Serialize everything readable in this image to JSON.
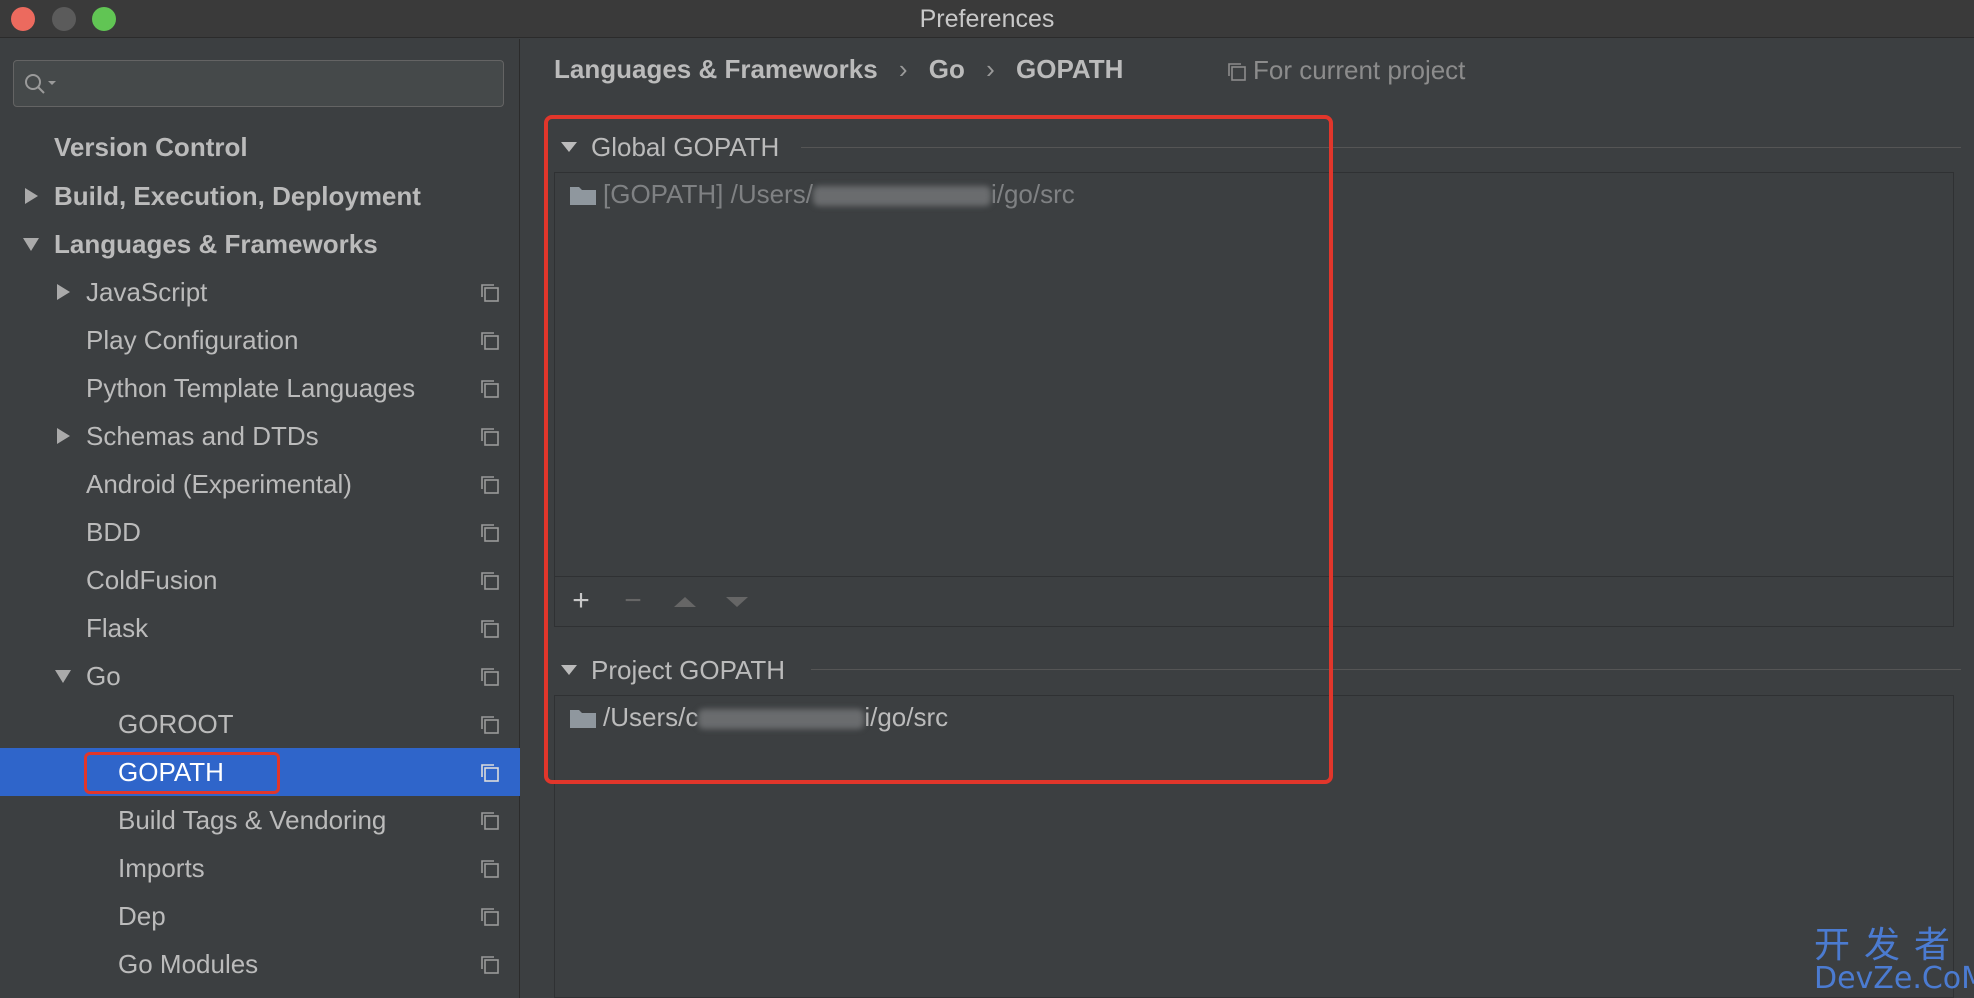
{
  "window": {
    "title": "Preferences"
  },
  "search": {
    "placeholder": ""
  },
  "sidebar": {
    "items": [
      {
        "label": "Version Control"
      },
      {
        "label": "Build, Execution, Deployment"
      },
      {
        "label": "Languages & Frameworks"
      },
      {
        "label": "JavaScript"
      },
      {
        "label": "Play Configuration"
      },
      {
        "label": "Python Template Languages"
      },
      {
        "label": "Schemas and DTDs"
      },
      {
        "label": "Android (Experimental)"
      },
      {
        "label": "BDD"
      },
      {
        "label": "ColdFusion"
      },
      {
        "label": "Flask"
      },
      {
        "label": "Go"
      },
      {
        "label": "GOROOT"
      },
      {
        "label": "GOPATH"
      },
      {
        "label": "Build Tags & Vendoring"
      },
      {
        "label": "Imports"
      },
      {
        "label": "Dep"
      },
      {
        "label": "Go Modules"
      }
    ],
    "selected": "GOPATH"
  },
  "breadcrumb": {
    "parts": [
      "Languages & Frameworks",
      "Go",
      "GOPATH"
    ],
    "separator": "›"
  },
  "scope": {
    "label": "For current project"
  },
  "global_gopath": {
    "title": "Global GOPATH",
    "entries": [
      {
        "prefix": "[GOPATH] /Users/",
        "suffix": "i/go/src"
      }
    ]
  },
  "project_gopath": {
    "title": "Project GOPATH",
    "entries": [
      {
        "prefix": "/Users/c",
        "suffix": "i/go/src"
      }
    ]
  },
  "toolbar": {
    "add": "+",
    "remove": "−"
  },
  "watermark": {
    "top": "开发者",
    "bottom": "DevZe.CoM"
  },
  "colors": {
    "selection": "#2f65ca",
    "highlight": "#e1362b",
    "background": "#3c3f41"
  }
}
